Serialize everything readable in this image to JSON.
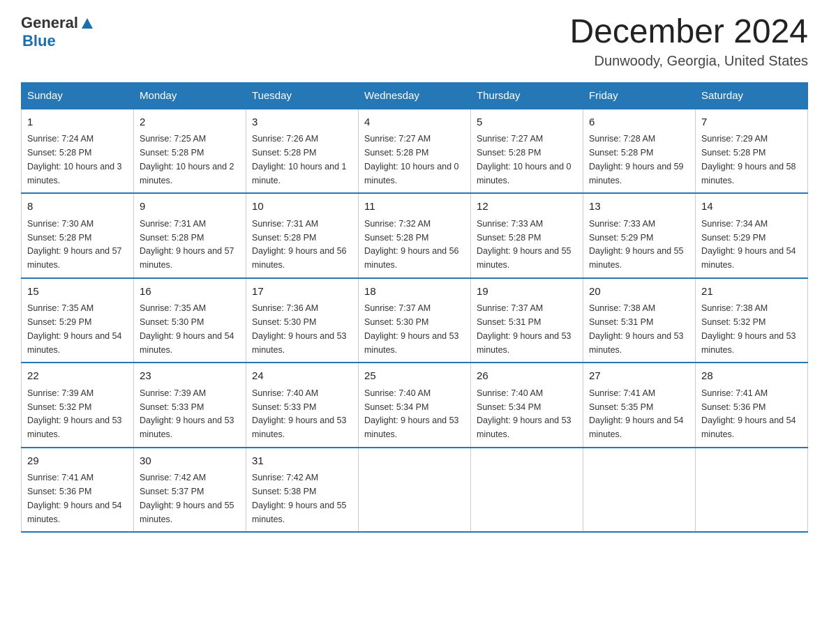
{
  "header": {
    "logo_general": "General",
    "logo_blue": "Blue",
    "title": "December 2024",
    "subtitle": "Dunwoody, Georgia, United States"
  },
  "days_of_week": [
    "Sunday",
    "Monday",
    "Tuesday",
    "Wednesday",
    "Thursday",
    "Friday",
    "Saturday"
  ],
  "weeks": [
    [
      {
        "day": "1",
        "sunrise": "7:24 AM",
        "sunset": "5:28 PM",
        "daylight": "10 hours and 3 minutes."
      },
      {
        "day": "2",
        "sunrise": "7:25 AM",
        "sunset": "5:28 PM",
        "daylight": "10 hours and 2 minutes."
      },
      {
        "day": "3",
        "sunrise": "7:26 AM",
        "sunset": "5:28 PM",
        "daylight": "10 hours and 1 minute."
      },
      {
        "day": "4",
        "sunrise": "7:27 AM",
        "sunset": "5:28 PM",
        "daylight": "10 hours and 0 minutes."
      },
      {
        "day": "5",
        "sunrise": "7:27 AM",
        "sunset": "5:28 PM",
        "daylight": "10 hours and 0 minutes."
      },
      {
        "day": "6",
        "sunrise": "7:28 AM",
        "sunset": "5:28 PM",
        "daylight": "9 hours and 59 minutes."
      },
      {
        "day": "7",
        "sunrise": "7:29 AM",
        "sunset": "5:28 PM",
        "daylight": "9 hours and 58 minutes."
      }
    ],
    [
      {
        "day": "8",
        "sunrise": "7:30 AM",
        "sunset": "5:28 PM",
        "daylight": "9 hours and 57 minutes."
      },
      {
        "day": "9",
        "sunrise": "7:31 AM",
        "sunset": "5:28 PM",
        "daylight": "9 hours and 57 minutes."
      },
      {
        "day": "10",
        "sunrise": "7:31 AM",
        "sunset": "5:28 PM",
        "daylight": "9 hours and 56 minutes."
      },
      {
        "day": "11",
        "sunrise": "7:32 AM",
        "sunset": "5:28 PM",
        "daylight": "9 hours and 56 minutes."
      },
      {
        "day": "12",
        "sunrise": "7:33 AM",
        "sunset": "5:28 PM",
        "daylight": "9 hours and 55 minutes."
      },
      {
        "day": "13",
        "sunrise": "7:33 AM",
        "sunset": "5:29 PM",
        "daylight": "9 hours and 55 minutes."
      },
      {
        "day": "14",
        "sunrise": "7:34 AM",
        "sunset": "5:29 PM",
        "daylight": "9 hours and 54 minutes."
      }
    ],
    [
      {
        "day": "15",
        "sunrise": "7:35 AM",
        "sunset": "5:29 PM",
        "daylight": "9 hours and 54 minutes."
      },
      {
        "day": "16",
        "sunrise": "7:35 AM",
        "sunset": "5:30 PM",
        "daylight": "9 hours and 54 minutes."
      },
      {
        "day": "17",
        "sunrise": "7:36 AM",
        "sunset": "5:30 PM",
        "daylight": "9 hours and 53 minutes."
      },
      {
        "day": "18",
        "sunrise": "7:37 AM",
        "sunset": "5:30 PM",
        "daylight": "9 hours and 53 minutes."
      },
      {
        "day": "19",
        "sunrise": "7:37 AM",
        "sunset": "5:31 PM",
        "daylight": "9 hours and 53 minutes."
      },
      {
        "day": "20",
        "sunrise": "7:38 AM",
        "sunset": "5:31 PM",
        "daylight": "9 hours and 53 minutes."
      },
      {
        "day": "21",
        "sunrise": "7:38 AM",
        "sunset": "5:32 PM",
        "daylight": "9 hours and 53 minutes."
      }
    ],
    [
      {
        "day": "22",
        "sunrise": "7:39 AM",
        "sunset": "5:32 PM",
        "daylight": "9 hours and 53 minutes."
      },
      {
        "day": "23",
        "sunrise": "7:39 AM",
        "sunset": "5:33 PM",
        "daylight": "9 hours and 53 minutes."
      },
      {
        "day": "24",
        "sunrise": "7:40 AM",
        "sunset": "5:33 PM",
        "daylight": "9 hours and 53 minutes."
      },
      {
        "day": "25",
        "sunrise": "7:40 AM",
        "sunset": "5:34 PM",
        "daylight": "9 hours and 53 minutes."
      },
      {
        "day": "26",
        "sunrise": "7:40 AM",
        "sunset": "5:34 PM",
        "daylight": "9 hours and 53 minutes."
      },
      {
        "day": "27",
        "sunrise": "7:41 AM",
        "sunset": "5:35 PM",
        "daylight": "9 hours and 54 minutes."
      },
      {
        "day": "28",
        "sunrise": "7:41 AM",
        "sunset": "5:36 PM",
        "daylight": "9 hours and 54 minutes."
      }
    ],
    [
      {
        "day": "29",
        "sunrise": "7:41 AM",
        "sunset": "5:36 PM",
        "daylight": "9 hours and 54 minutes."
      },
      {
        "day": "30",
        "sunrise": "7:42 AM",
        "sunset": "5:37 PM",
        "daylight": "9 hours and 55 minutes."
      },
      {
        "day": "31",
        "sunrise": "7:42 AM",
        "sunset": "5:38 PM",
        "daylight": "9 hours and 55 minutes."
      },
      null,
      null,
      null,
      null
    ]
  ],
  "labels": {
    "sunrise": "Sunrise:",
    "sunset": "Sunset:",
    "daylight": "Daylight:"
  }
}
